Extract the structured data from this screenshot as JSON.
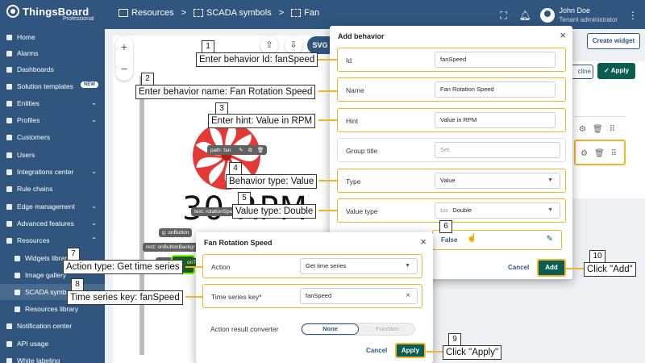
{
  "app": {
    "logo_name": "ThingsBoard",
    "logo_sub": "Professional"
  },
  "breadcrumb": [
    "Resources",
    "SCADA symbols",
    "Fan"
  ],
  "user": {
    "name": "John Doe",
    "role": "Tenant administrator"
  },
  "sidebar": {
    "items": [
      {
        "label": "Home"
      },
      {
        "label": "Alarms"
      },
      {
        "label": "Dashboards"
      },
      {
        "label": "Solution templates",
        "badge": "NEW"
      },
      {
        "label": "Entities"
      },
      {
        "label": "Profiles"
      },
      {
        "label": "Customers"
      },
      {
        "label": "Users"
      },
      {
        "label": "Integrations center"
      },
      {
        "label": "Rule chains"
      },
      {
        "label": "Edge management"
      },
      {
        "label": "Advanced features"
      },
      {
        "label": "Resources"
      },
      {
        "label": "Widgets library"
      },
      {
        "label": "Image gallery"
      },
      {
        "label": "SCADA symbols"
      },
      {
        "label": "Resources library"
      },
      {
        "label": "Notification center"
      },
      {
        "label": "API usage"
      },
      {
        "label": "White labeling"
      }
    ]
  },
  "toolbar": {
    "zoom_in": "+",
    "zoom_out": "−",
    "svg_label": "SVG",
    "create_widget": "Create widget",
    "decline_label": "cline",
    "apply_label": "Apply"
  },
  "canvas": {
    "rpm_text": "30 RPM",
    "tags": {
      "path_fan": "path:  fan",
      "text_rotation": "text:  rotationSpe",
      "g_onbutton": "g:  onButton",
      "rect_onbutton": "rect:  onButtonBackgr",
      "rect_onbutton2": "rect:  onButton",
      "on_text": "onTe"
    }
  },
  "add_behavior": {
    "title": "Add behavior",
    "fields": {
      "id": {
        "label": "Id",
        "value": "fanSpeed"
      },
      "name": {
        "label": "Name",
        "value": "Fan Rotation Speed"
      },
      "hint": {
        "label": "Hint",
        "value": "Value in RPM"
      },
      "group_title": {
        "label": "Group title",
        "placeholder": "Set"
      },
      "type": {
        "label": "Type",
        "value": "Value"
      },
      "value_type": {
        "label": "Value type",
        "value": "Double",
        "prefix": "123"
      }
    },
    "false_label": "False",
    "cancel": "Cancel",
    "add": "Add"
  },
  "fan_dialog": {
    "title": "Fan Rotation Speed",
    "action": {
      "label": "Action",
      "value": "Get time series"
    },
    "ts_key": {
      "label": "Time series key*",
      "value": "fanSpeed"
    },
    "converter": {
      "label": "Action result converter",
      "options": [
        "None",
        "Function"
      ]
    },
    "cancel": "Cancel",
    "apply": "Apply"
  },
  "callouts": [
    {
      "n": "1",
      "text": "Enter behavior Id: fanSpeed"
    },
    {
      "n": "2",
      "text": "Enter behavior name: Fan Rotation Speed"
    },
    {
      "n": "3",
      "text": "Enter hint: Value in RPM"
    },
    {
      "n": "4",
      "text": "Behavior type: Value"
    },
    {
      "n": "5",
      "text": "Value type: Double"
    },
    {
      "n": "6",
      "text": ""
    },
    {
      "n": "7",
      "text": "Action type: Get time series"
    },
    {
      "n": "8",
      "text": "Time series key: fanSpeed"
    },
    {
      "n": "9",
      "text": "Click \"Apply\""
    },
    {
      "n": "10",
      "text": "Click \"Add\""
    }
  ],
  "colors": {
    "brand": "#305680",
    "accent": "#0b5d52",
    "highlight": "#f3b32a",
    "fan": "#e53935"
  }
}
